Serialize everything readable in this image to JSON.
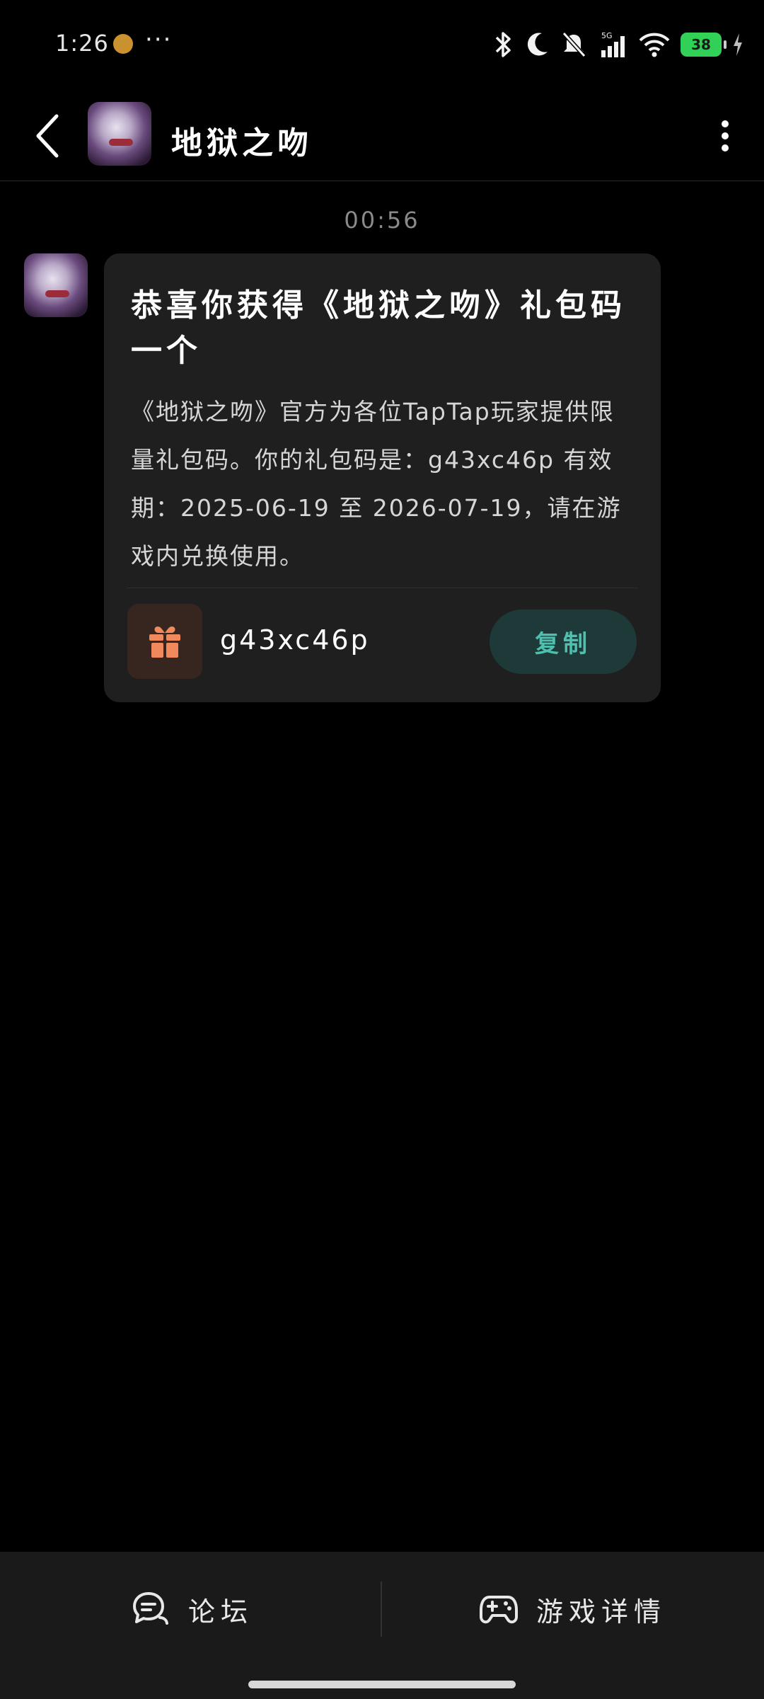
{
  "status_bar": {
    "time": "1:26",
    "more": "···",
    "network": "5G",
    "battery": "38"
  },
  "header": {
    "title": "地狱之吻",
    "back_icon": "chevron-left-icon",
    "menu_icon": "vertical-ellipsis-icon"
  },
  "chat": {
    "timestamp": "00:56",
    "message": {
      "title": "恭喜你获得《地狱之吻》礼包码一个",
      "body": "《地狱之吻》官方为各位TapTap玩家提供限量礼包码。你的礼包码是：g43xc46p 有效期：2025-06-19 至 2026-07-19，请在游戏内兑换使用。",
      "gift_code": "g43xc46p",
      "copy_label": "复制",
      "gift_icon": "gift-icon"
    }
  },
  "colors": {
    "accent": "#4fc0b0",
    "copy_bg": "#1d3a38",
    "gift_icon": "#f08a5d",
    "card_bg": "#1f1f1f"
  },
  "bottom_bar": {
    "forum_label": "论坛",
    "game_details_label": "游戏详情"
  }
}
